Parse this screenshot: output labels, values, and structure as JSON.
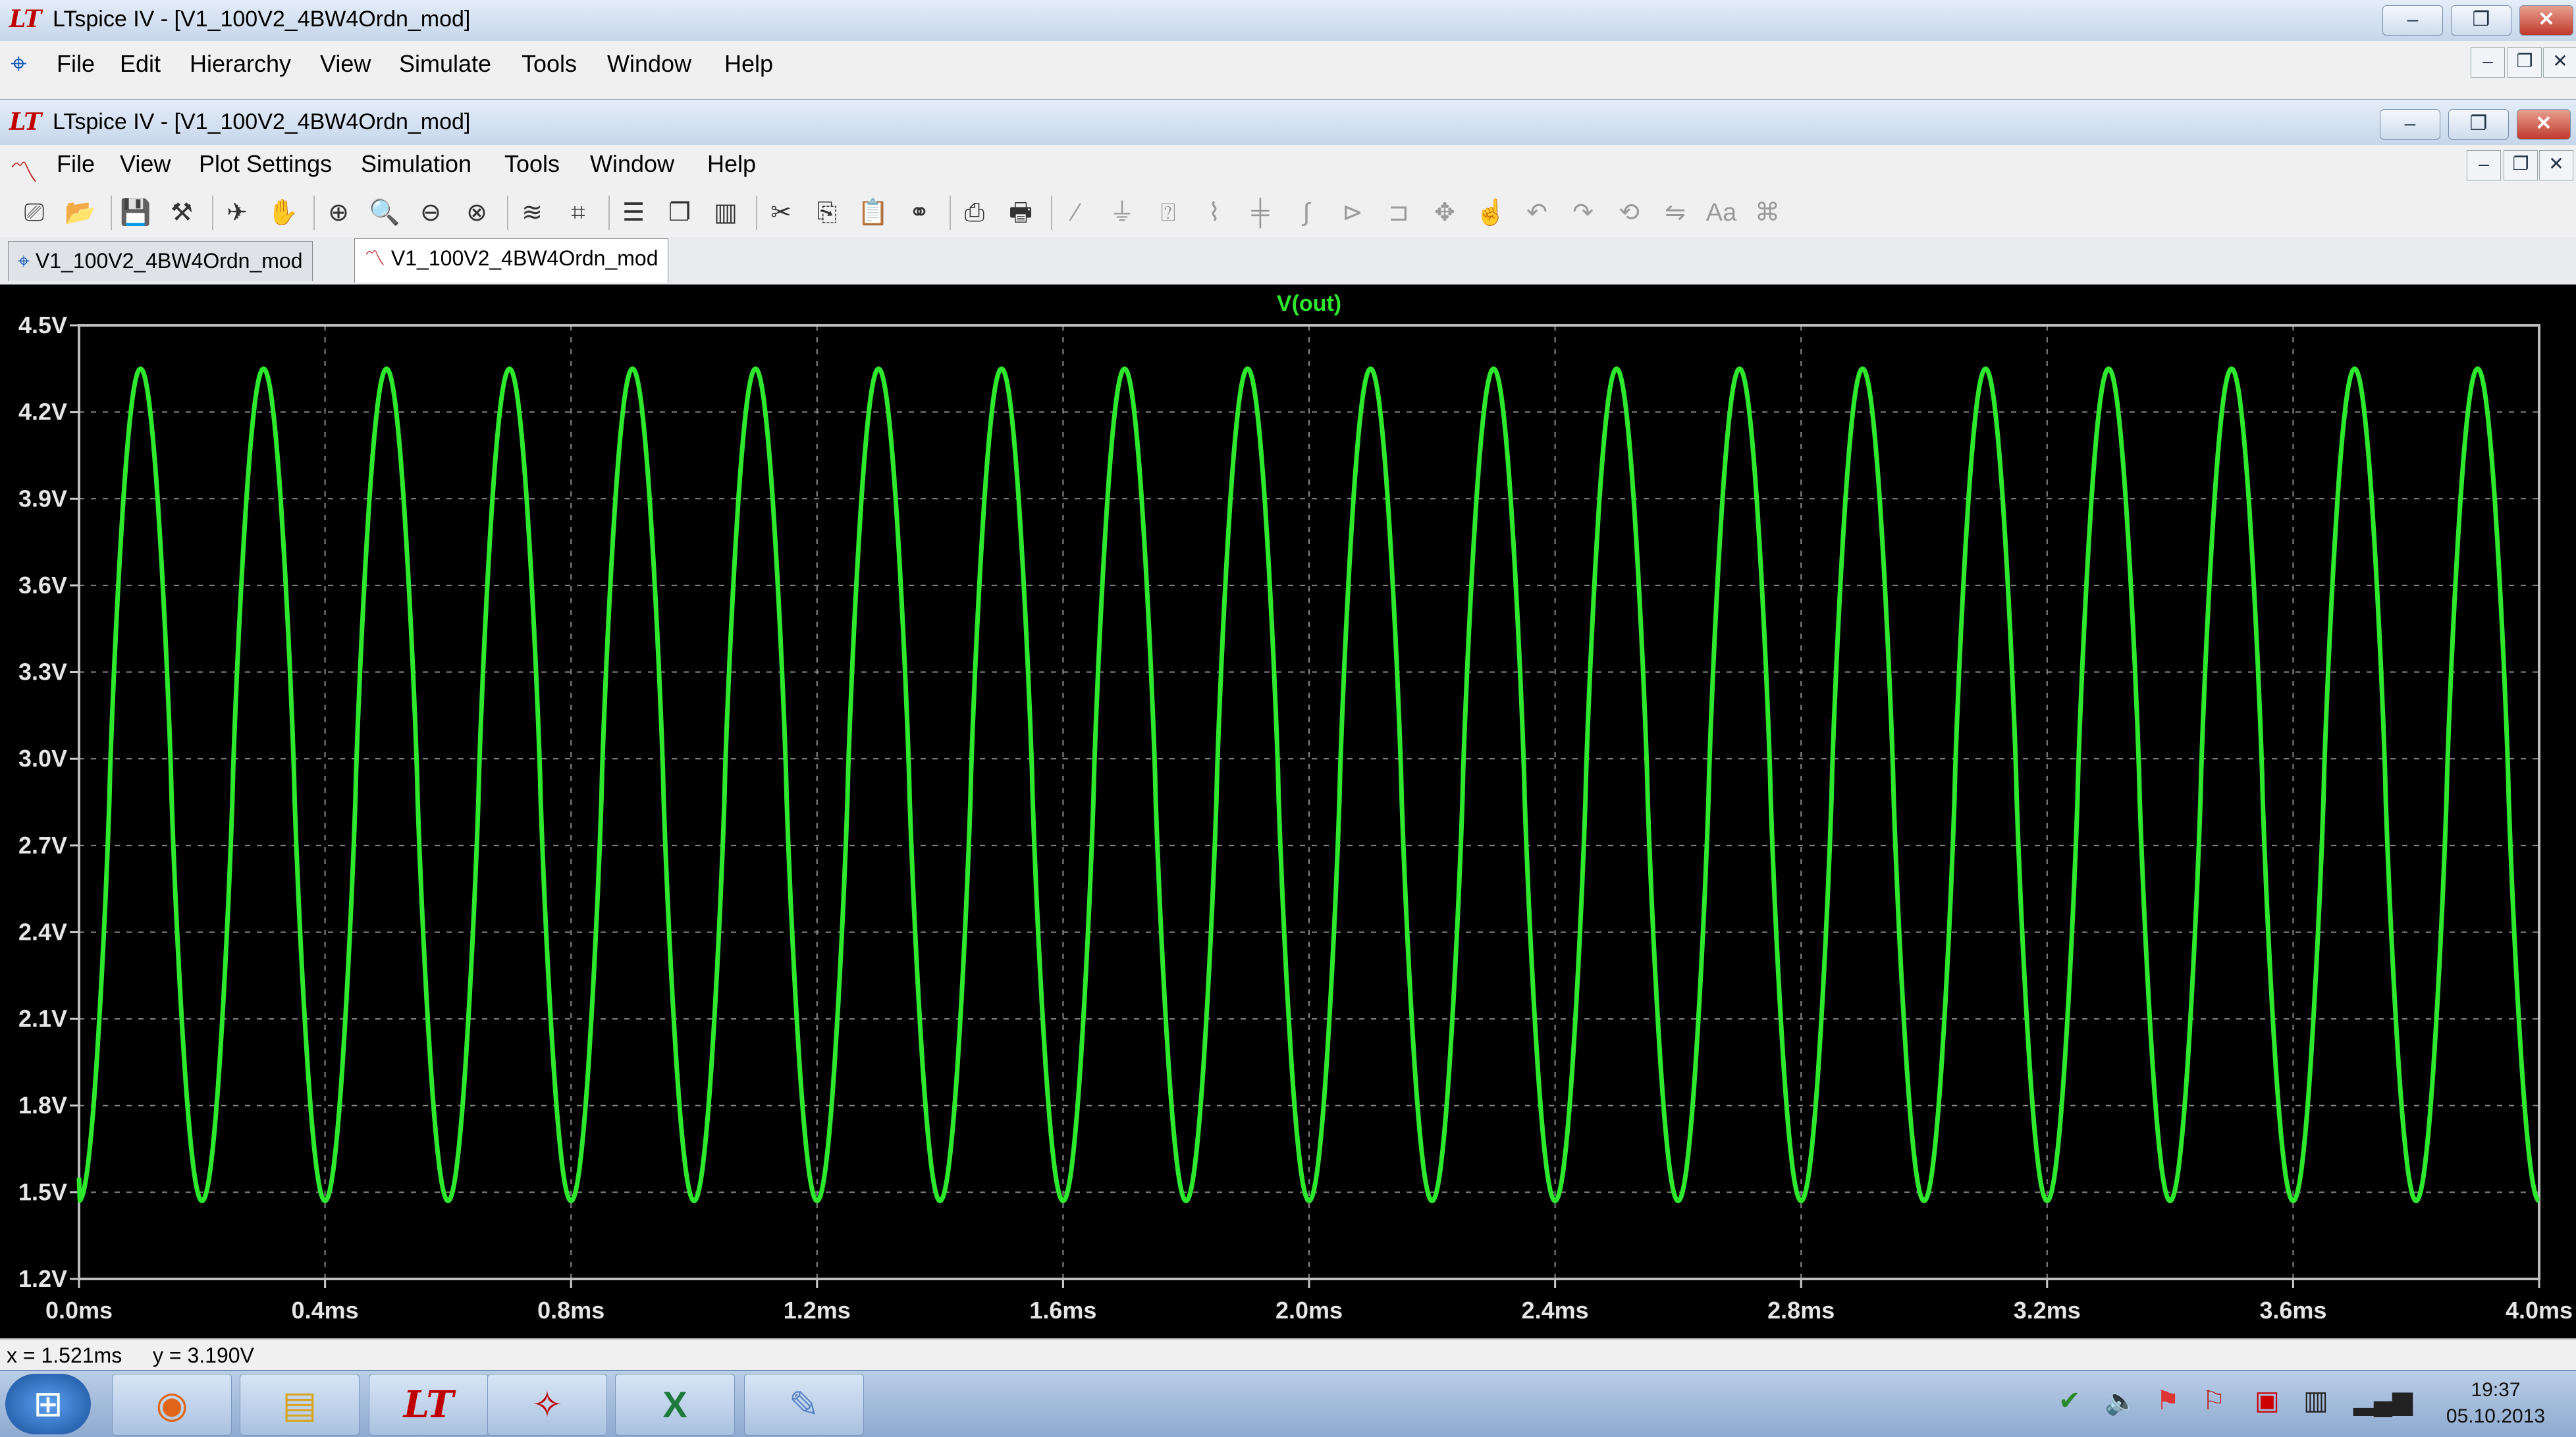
{
  "outer_window": {
    "title": "LTspice IV - [V1_100V2_4BW4Ordn_mod]",
    "menu": [
      "File",
      "Edit",
      "Hierarchy",
      "View",
      "Simulate",
      "Tools",
      "Window",
      "Help"
    ],
    "buttons": {
      "minimize": "–",
      "restore": "❐",
      "close": "✕"
    }
  },
  "inner_window": {
    "title": "LTspice IV - [V1_100V2_4BW4Ordn_mod]",
    "menu": [
      "File",
      "View",
      "Plot Settings",
      "Simulation",
      "Tools",
      "Window",
      "Help"
    ],
    "buttons": {
      "minimize": "–",
      "restore": "❐",
      "close": "✕"
    }
  },
  "toolbar_icons": [
    "new-schematic-icon",
    "open-icon",
    "save-icon",
    "control-panel-icon",
    "run-icon",
    "halt-icon",
    "zoom-in-icon",
    "zoom-area-icon",
    "zoom-out-icon",
    "zoom-fit-icon",
    "autorange-icon",
    "unzoom-icon",
    "tile-horizontal-icon",
    "cascade-icon",
    "tile-vertical-icon",
    "cut-icon",
    "copy-icon",
    "paste-icon",
    "find-icon",
    "print-preview-icon",
    "print-icon",
    "wire-icon",
    "ground-icon",
    "label-icon",
    "resistor-icon",
    "capacitor-icon",
    "inductor-icon",
    "diode-icon",
    "component-icon",
    "move-icon",
    "drag-icon",
    "undo-icon",
    "redo-icon",
    "rotate-icon",
    "mirror-icon",
    "text-icon",
    "spice-directive-icon"
  ],
  "tabs": [
    {
      "label": "V1_100V2_4BW4Ordn_mod",
      "icon": "schematic-icon",
      "active": false
    },
    {
      "label": "V1_100V2_4BW4Ordn_mod",
      "icon": "waveform-icon",
      "active": true
    }
  ],
  "chart_data": {
    "type": "line",
    "title": "V(out)",
    "xlabel": "",
    "ylabel": "",
    "xlim": [
      0,
      4.0
    ],
    "ylim": [
      1.2,
      4.5
    ],
    "x_ticks": [
      "0.0ms",
      "0.4ms",
      "0.8ms",
      "1.2ms",
      "1.6ms",
      "2.0ms",
      "2.4ms",
      "2.8ms",
      "3.2ms",
      "3.6ms",
      "4.0ms"
    ],
    "y_ticks": [
      "1.2V",
      "1.5V",
      "1.8V",
      "2.1V",
      "2.4V",
      "2.7V",
      "3.0V",
      "3.3V",
      "3.6V",
      "3.9V",
      "4.2V",
      "4.5V"
    ],
    "grid": true,
    "background": "#000000",
    "trace_color": "#2ee82e",
    "series": [
      {
        "name": "V(out)",
        "start_ms": 0.0,
        "start_V": 1.55,
        "period_ms": 0.2,
        "first_peak_ms": 0.1,
        "peak_V": 4.35,
        "trough_V": 1.47
      }
    ]
  },
  "status": {
    "x": "x = 1.521ms",
    "y": "y = 3.190V"
  },
  "taskbar": {
    "apps": [
      "start-orb-icon",
      "firefox-icon",
      "explorer-icon",
      "ltspice-icon",
      "acrobat-icon",
      "excel-icon",
      "paint-icon"
    ],
    "clock_time": "19:37",
    "clock_date": "05.10.2013"
  }
}
